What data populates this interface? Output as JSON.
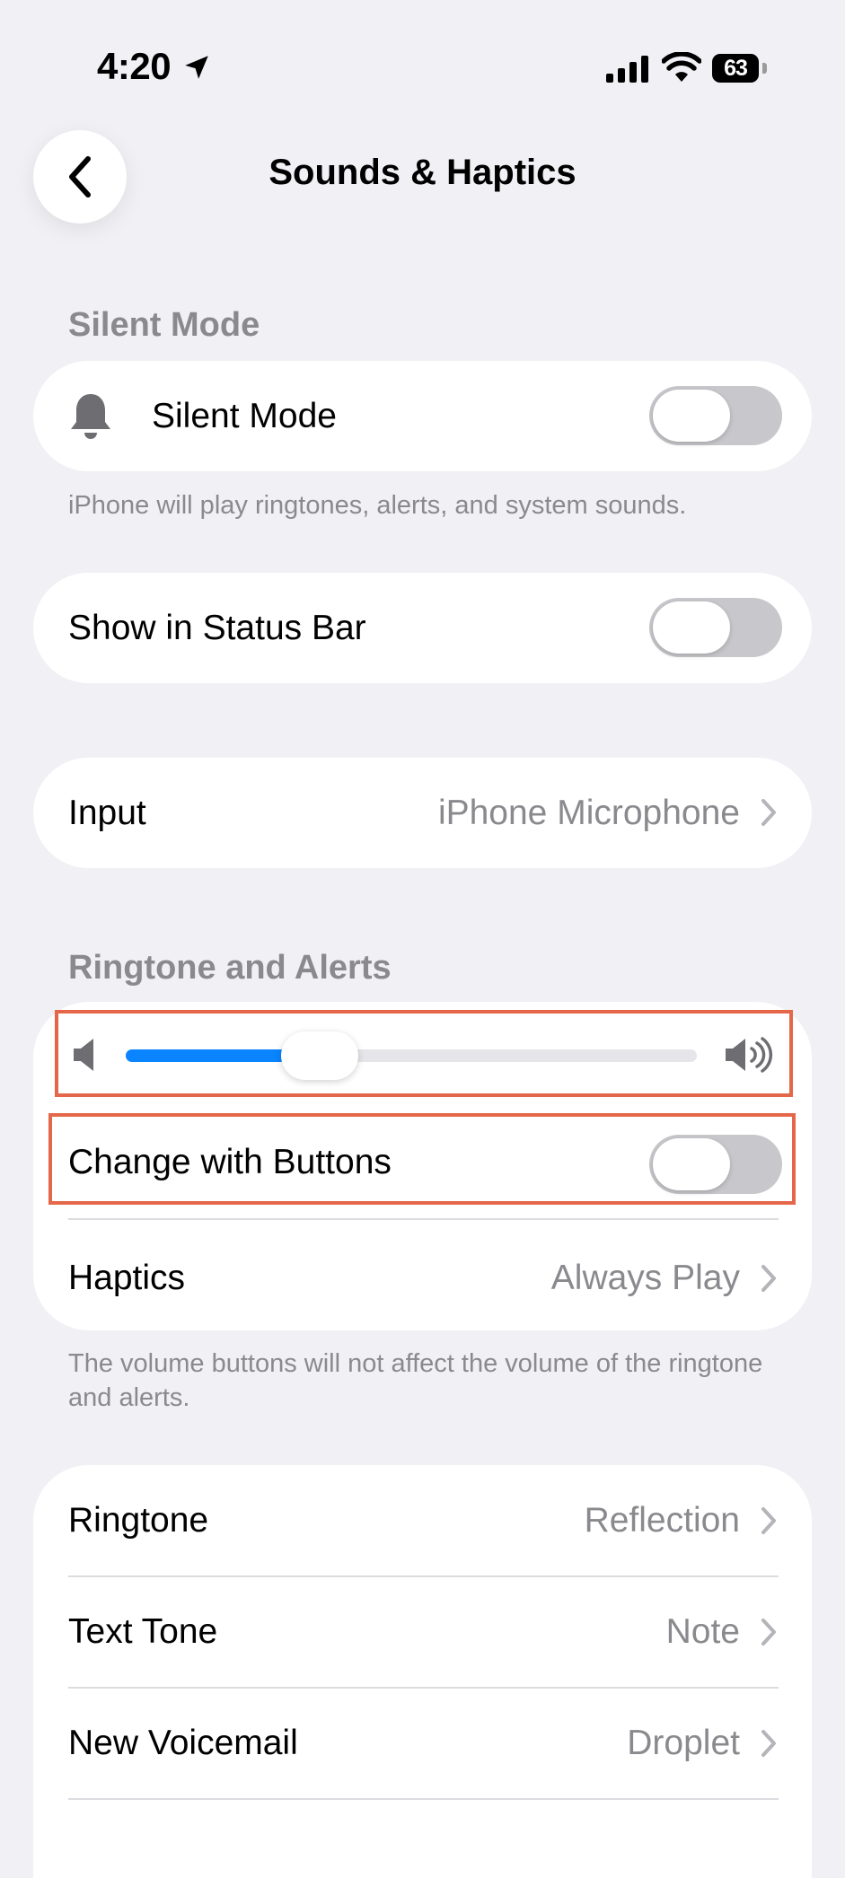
{
  "status_bar": {
    "time": "4:20",
    "battery": "63"
  },
  "header": {
    "title": "Sounds & Haptics"
  },
  "silent_mode": {
    "section_header": "Silent Mode",
    "row_label": "Silent Mode",
    "toggle_on": false,
    "footer": "iPhone will play ringtones, alerts, and system sounds."
  },
  "status_bar_row": {
    "label": "Show in Status Bar",
    "toggle_on": false
  },
  "input_row": {
    "label": "Input",
    "value": "iPhone Microphone"
  },
  "ringtone_alerts": {
    "section_header": "Ringtone and Alerts",
    "volume_level": 0.34,
    "change_with_buttons_label": "Change with Buttons",
    "change_with_buttons_on": false,
    "haptics_label": "Haptics",
    "haptics_value": "Always Play",
    "footer": "The volume buttons will not affect the volume of the ringtone and alerts."
  },
  "sounds": [
    {
      "label": "Ringtone",
      "value": "Reflection"
    },
    {
      "label": "Text Tone",
      "value": "Note"
    },
    {
      "label": "New Voicemail",
      "value": "Droplet"
    }
  ],
  "colors": {
    "accent": "#0a84ff",
    "highlight": "#e5674a",
    "background": "#f0f0f5"
  }
}
